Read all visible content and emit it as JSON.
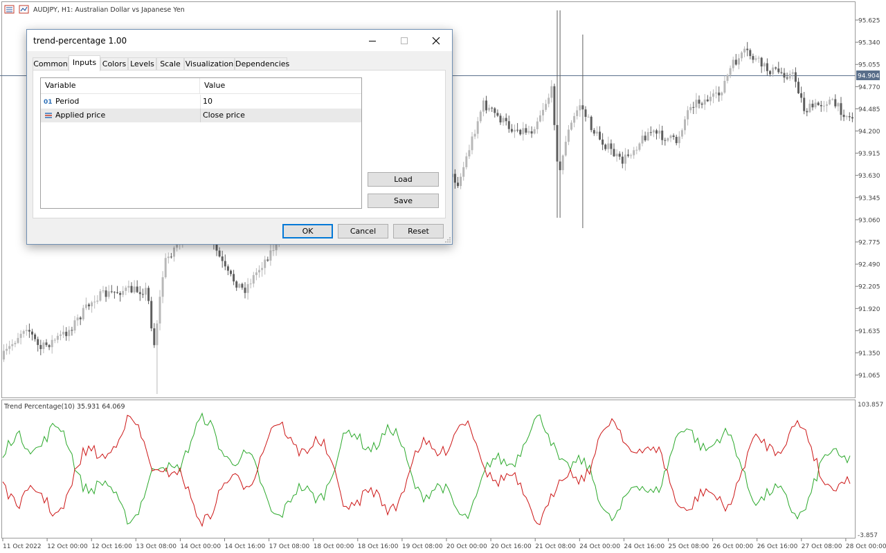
{
  "window": {
    "symbol_title": "AUDJPY, H1:  Australian Dollar vs Japanese Yen",
    "icons": [
      "chart-window-icon",
      "chart-type-icon"
    ]
  },
  "price_axis": {
    "ticks": [
      "95.625",
      "95.340",
      "95.055",
      "94.770",
      "94.485",
      "94.200",
      "93.915",
      "93.630",
      "93.345",
      "93.060",
      "92.775",
      "92.490",
      "92.205",
      "91.920",
      "91.635",
      "91.350",
      "91.065"
    ],
    "current_price": "94.904",
    "current_price_color": "#596e8a"
  },
  "indicator": {
    "label": "Trend Percentage(10) 35.931 64.069",
    "axis_max": "103.857",
    "axis_min": "-3.857",
    "up_color": "#2aa82a",
    "down_color": "#cc1414"
  },
  "time_axis": [
    "11 Oct 2022",
    "12 Oct 00:00",
    "12 Oct 16:00",
    "13 Oct 08:00",
    "14 Oct 00:00",
    "14 Oct 16:00",
    "17 Oct 08:00",
    "18 Oct 00:00",
    "18 Oct 16:00",
    "19 Oct 08:00",
    "20 Oct 00:00",
    "20 Oct 16:00",
    "21 Oct 08:00",
    "24 Oct 00:00",
    "24 Oct 16:00",
    "25 Oct 08:00",
    "26 Oct 00:00",
    "26 Oct 16:00",
    "27 Oct 08:00",
    "28 Oct 00:00"
  ],
  "dialog": {
    "title": "trend-percentage 1.00",
    "tabs": [
      "Common",
      "Inputs",
      "Colors",
      "Levels",
      "Scale",
      "Visualization",
      "Dependencies"
    ],
    "active_tab": "Inputs",
    "columns": [
      "Variable",
      "Value"
    ],
    "rows": [
      {
        "icon": "integer-param-icon",
        "name": "Period",
        "value": "10"
      },
      {
        "icon": "price-enum-icon",
        "name": "Applied price",
        "value": "Close price"
      }
    ],
    "load_label": "Load",
    "save_label": "Save",
    "ok_label": "OK",
    "cancel_label": "Cancel",
    "reset_label": "Reset"
  }
}
